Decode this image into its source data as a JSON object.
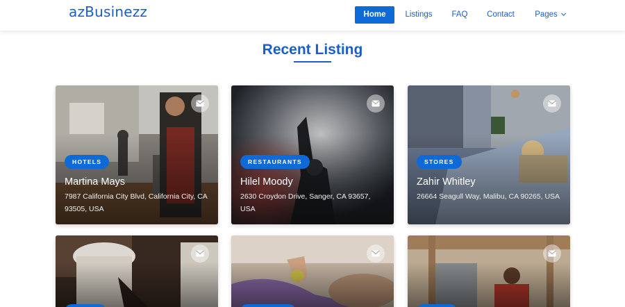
{
  "brand": "azBusinezz",
  "nav": {
    "items": [
      {
        "label": "Home",
        "active": true
      },
      {
        "label": "Listings",
        "active": false
      },
      {
        "label": "FAQ",
        "active": false
      },
      {
        "label": "Contact",
        "active": false
      },
      {
        "label": "Pages",
        "active": false
      }
    ]
  },
  "section": {
    "title": "Recent Listing"
  },
  "listings": [
    {
      "category": "HOTELS",
      "name": "Martina Mays",
      "address": "7987 California City Blvd, California City, CA 93505, USA"
    },
    {
      "category": "RESTAURANTS",
      "name": "Hilel Moody",
      "address": "2630 Croydon Drive, Sanger, CA 93657, USA"
    },
    {
      "category": "STORES",
      "name": "Zahir Whitley",
      "address": "26664 Seagull Way, Malibu, CA 90265, USA"
    }
  ],
  "colors": {
    "accent": "#0d6ad6",
    "brand": "#1a5fc8"
  },
  "icons": {
    "card_action": "mail-icon",
    "dropdown": "chevron-down-icon"
  }
}
